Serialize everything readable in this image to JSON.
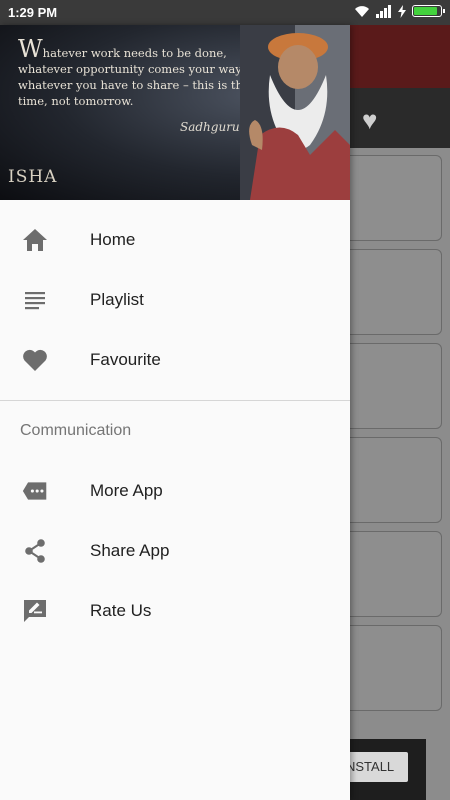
{
  "status_bar": {
    "time": "1:29 PM",
    "battery_level": 0.9,
    "battery_color": "#43d13d"
  },
  "background_app": {
    "toolbar_color": "#5a1a1a",
    "install_label": "NSTALL"
  },
  "drawer": {
    "header": {
      "quote_first_letter": "W",
      "quote_rest": "hatever work needs to be done, whatever opportunity comes your way, whatever you have to share – this is the time, not tomorrow.",
      "signature": "Sadhguru",
      "logo": "ISHA"
    },
    "main_items": [
      {
        "label": "Home",
        "icon": "home-icon"
      },
      {
        "label": "Playlist",
        "icon": "list-icon"
      },
      {
        "label": "Favourite",
        "icon": "heart-icon"
      }
    ],
    "section_title": "Communication",
    "communication_items": [
      {
        "label": "More App",
        "icon": "more-tag-icon"
      },
      {
        "label": "Share App",
        "icon": "share-icon"
      },
      {
        "label": "Rate Us",
        "icon": "rate-edit-icon"
      }
    ]
  }
}
